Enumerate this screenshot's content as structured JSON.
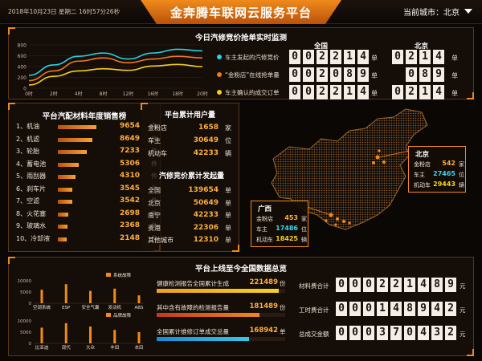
{
  "header": {
    "title": "金奔腾车联网云服务平台",
    "datetime": "2018年10月23日 星期二 16时57分26秒",
    "city_label": "当前城市：北京"
  },
  "realtime": {
    "title": "今日汽修竞价抢单实时监测",
    "col_national": "全国",
    "col_beijing": "北京",
    "chart": {
      "y_ticks": [
        "800",
        "600",
        "400",
        "200",
        "0"
      ],
      "x_ticks": [
        "0时",
        "2时",
        "4时",
        "8时",
        "12时",
        "16时",
        "18时",
        "20时"
      ]
    },
    "rows": [
      {
        "label": "车主发起的汽修竞价",
        "color": "#27d3e6",
        "national": [
          "0",
          "0",
          "2",
          "2",
          "1",
          "4"
        ],
        "beijing": [
          "0",
          "2",
          "1",
          "4"
        ],
        "unit": "单"
      },
      {
        "label": "“金粉店”在线抢单量",
        "color": "#f07a1a",
        "national": [
          "0",
          "0",
          "2",
          "0",
          "8",
          "9"
        ],
        "beijing": [
          "0",
          "8",
          "9"
        ],
        "unit": "单"
      },
      {
        "label": "车主确认的成交订单",
        "color": "#f5cf1d",
        "national": [
          "0",
          "0",
          "2",
          "2",
          "1",
          "4"
        ],
        "beijing": [
          "0",
          "2",
          "1",
          "4"
        ],
        "unit": "单"
      }
    ]
  },
  "chart_data": {
    "type": "line",
    "x": [
      "0时",
      "2时",
      "4时",
      "8时",
      "12时",
      "16时",
      "18时",
      "20时"
    ],
    "ylim": [
      0,
      800
    ],
    "series": [
      {
        "color": "#27d3e6",
        "values": [
          240,
          430,
          590,
          650,
          540,
          650,
          720,
          690
        ]
      },
      {
        "color": "#f07a1a",
        "values": [
          140,
          320,
          500,
          560,
          470,
          540,
          590,
          560
        ]
      },
      {
        "color": "#f5cf1d",
        "values": [
          60,
          220,
          320,
          360,
          330,
          410,
          440,
          400
        ]
      }
    ]
  },
  "ranking": {
    "title": "平台汽配材料年度销售榜",
    "unit": "件",
    "items": [
      {
        "label": "1、机油",
        "value": "9654",
        "pct": 1.0
      },
      {
        "label": "2、机滤",
        "value": "8649",
        "pct": 0.9
      },
      {
        "label": "3、轮胎",
        "value": "7233",
        "pct": 0.75
      },
      {
        "label": "4、蓄电池",
        "value": "5306",
        "pct": 0.55
      },
      {
        "label": "5、雨刮器",
        "value": "4310",
        "pct": 0.45
      },
      {
        "label": "6、刹车片",
        "value": "3545",
        "pct": 0.37
      },
      {
        "label": "7、空滤",
        "value": "3542",
        "pct": 0.37
      },
      {
        "label": "8、火花塞",
        "value": "2698",
        "pct": 0.28
      },
      {
        "label": "9、玻璃水",
        "value": "2368",
        "pct": 0.25
      },
      {
        "label": "10、冷却液",
        "value": "2148",
        "pct": 0.22
      }
    ]
  },
  "users": {
    "title": "平台累计用户量",
    "rows": [
      {
        "label": "金粉店",
        "value": "1658",
        "unit": "家"
      },
      {
        "label": "车主",
        "value": "30649",
        "unit": "位"
      },
      {
        "label": "机动车",
        "value": "42233",
        "unit": "辆"
      }
    ]
  },
  "bidding": {
    "title": "汽修竞价累计发起量",
    "unit": "单",
    "rows": [
      {
        "label": "全国",
        "value": "139654"
      },
      {
        "label": "北京",
        "value": "50649"
      },
      {
        "label": "南宁",
        "value": "42233"
      },
      {
        "label": "贵港",
        "value": "22306"
      },
      {
        "label": "其他城市",
        "value": "12310"
      }
    ]
  },
  "map": {
    "beijing": {
      "title": "北京",
      "rows": [
        {
          "label": "金粉店",
          "value": "542",
          "unit": "家",
          "color": "#ffae3b"
        },
        {
          "label": "车主",
          "value": "27465",
          "unit": "位",
          "color": "#36d7ef"
        },
        {
          "label": "机动车",
          "value": "29443",
          "unit": "辆",
          "color": "#f5d21d"
        }
      ]
    },
    "guangxi": {
      "title": "广西",
      "rows": [
        {
          "label": "金粉店",
          "value": "453",
          "unit": "家",
          "color": "#ffae3b"
        },
        {
          "label": "车主",
          "value": "17486",
          "unit": "位",
          "color": "#36d7ef"
        },
        {
          "label": "机动车",
          "value": "18425",
          "unit": "辆",
          "color": "#f5d21d"
        }
      ]
    }
  },
  "overview": {
    "title": "平台上线至今全国数据总览",
    "chart1": {
      "legend": "系统故障",
      "y_ticks": [
        "10000",
        "5000",
        "0"
      ],
      "categories": [
        "空调系统",
        "ESP",
        "安全气囊",
        "发动机",
        "ABS"
      ]
    },
    "chart2": {
      "legend": "品牌故障",
      "y_ticks": [
        "10000",
        "5000",
        "0"
      ],
      "categories": [
        "比亚迪",
        "现代",
        "大众",
        "丰田",
        "本田"
      ]
    },
    "reports": [
      {
        "label": "健康检测报告全国累计生成",
        "value": "221489",
        "unit": "份",
        "pct": 0.95,
        "gradient": "linear-gradient(90deg,#f0a020,#f7d21d)"
      },
      {
        "label": "其中含有故障的检测报告量",
        "value": "181489",
        "unit": "份",
        "pct": 0.8,
        "gradient": "linear-gradient(90deg,#c23a1a,#f08a1c)"
      },
      {
        "label": "全国累计维修订单成交总量",
        "value": "168942",
        "unit": "单",
        "pct": 0.72,
        "gradient": "linear-gradient(90deg,#1a8ad8,#35c8e8)"
      }
    ],
    "totals": [
      {
        "label": "材料费合计",
        "digits": [
          "0",
          "0",
          "0",
          "2",
          "2",
          "1",
          "4",
          "8",
          "9"
        ],
        "unit": "元"
      },
      {
        "label": "工时费合计",
        "digits": [
          "0",
          "0",
          "0",
          "1",
          "4",
          "8",
          "9",
          "4",
          "2"
        ],
        "unit": "元"
      },
      {
        "label": "总成交金额",
        "digits": [
          "0",
          "0",
          "0",
          "3",
          "7",
          "0",
          "4",
          "3",
          "2"
        ],
        "unit": "元"
      }
    ]
  }
}
